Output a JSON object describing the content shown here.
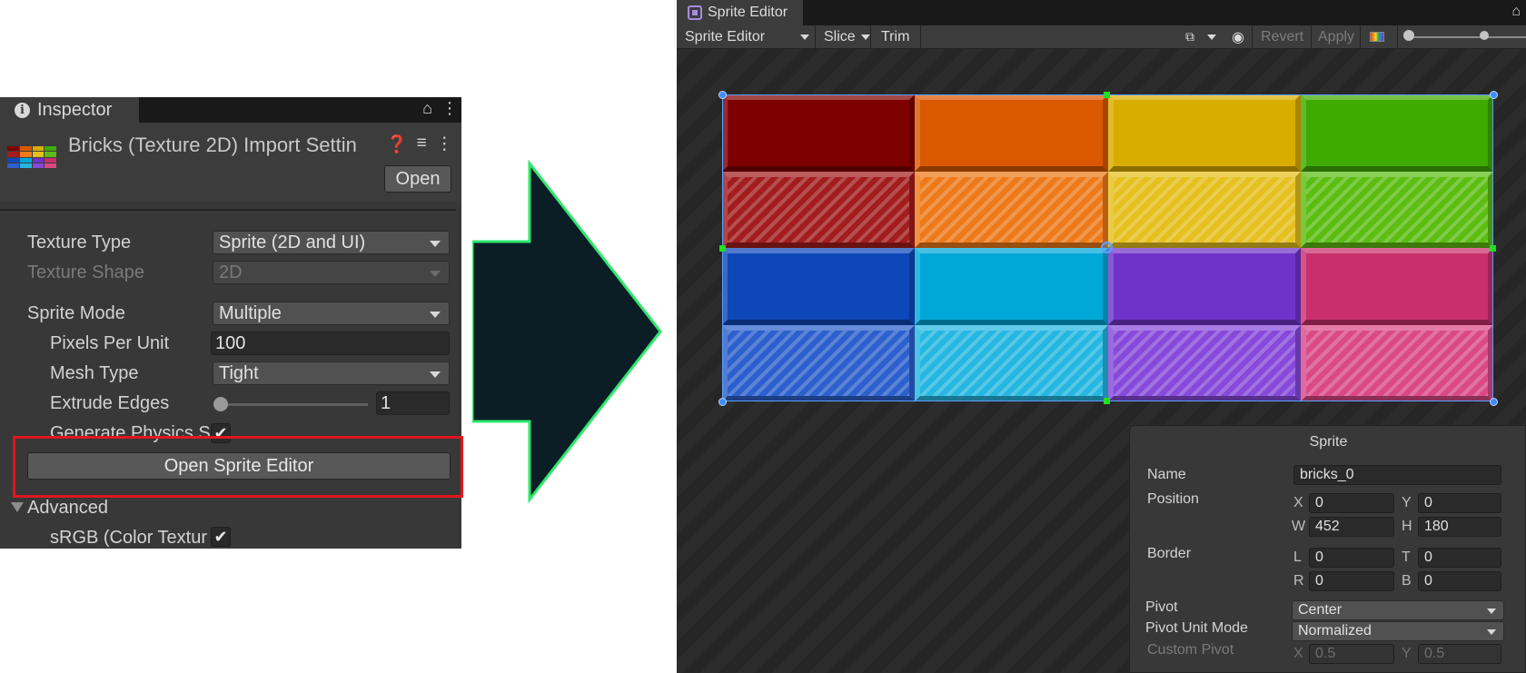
{
  "inspector": {
    "tab_label": "Inspector",
    "title": "Bricks (Texture 2D) Import Settin",
    "open_button": "Open",
    "texture_type_label": "Texture Type",
    "texture_type_value": "Sprite (2D and UI)",
    "texture_shape_label": "Texture Shape",
    "texture_shape_value": "2D",
    "sprite_mode_label": "Sprite Mode",
    "sprite_mode_value": "Multiple",
    "pixels_per_unit_label": "Pixels Per Unit",
    "pixels_per_unit_value": "100",
    "mesh_type_label": "Mesh Type",
    "mesh_type_value": "Tight",
    "extrude_edges_label": "Extrude Edges",
    "extrude_edges_value": "1",
    "generate_physics_label": "Generate Physics S",
    "generate_physics_checked": true,
    "open_sprite_editor_button": "Open Sprite Editor",
    "advanced_label": "Advanced",
    "srgb_label": "sRGB (Color Textur",
    "srgb_checked": true
  },
  "sprite_editor": {
    "tab_label": "Sprite Editor",
    "toolbar": {
      "mode_dropdown": "Sprite Editor",
      "slice": "Slice",
      "trim": "Trim",
      "revert": "Revert",
      "apply": "Apply"
    },
    "sheet": {
      "bricks": [
        {
          "color": "#7e0000",
          "striped": false
        },
        {
          "color": "#d95800",
          "striped": false
        },
        {
          "color": "#d9ac00",
          "striped": false
        },
        {
          "color": "#3faa00",
          "striped": false
        },
        {
          "color": "#a21d1d",
          "striped": true
        },
        {
          "color": "#ed7a1a",
          "striped": true
        },
        {
          "color": "#e5c01f",
          "striped": true
        },
        {
          "color": "#5bbd12",
          "striped": true
        },
        {
          "color": "#0e47b8",
          "striped": false
        },
        {
          "color": "#00a8d8",
          "striped": false
        },
        {
          "color": "#7033c9",
          "striped": false
        },
        {
          "color": "#c92f6b",
          "striped": false
        },
        {
          "color": "#2c60cc",
          "striped": true
        },
        {
          "color": "#25b7e0",
          "striped": true
        },
        {
          "color": "#8649d9",
          "striped": true
        },
        {
          "color": "#d94a85",
          "striped": true
        }
      ]
    },
    "sprite_panel": {
      "title": "Sprite",
      "name_label": "Name",
      "name_value": "bricks_0",
      "position_label": "Position",
      "x_axis": "X",
      "x_value": "0",
      "y_axis": "Y",
      "y_value": "0",
      "w_axis": "W",
      "w_value": "452",
      "h_axis": "H",
      "h_value": "180",
      "border_label": "Border",
      "l_axis": "L",
      "l_value": "0",
      "t_axis": "T",
      "t_value": "0",
      "r_axis": "R",
      "r_value": "0",
      "b_axis": "B",
      "b_value": "0",
      "pivot_label": "Pivot",
      "pivot_value": "Center",
      "pivot_unit_label": "Pivot Unit Mode",
      "pivot_unit_value": "Normalized",
      "custom_pivot_label": "Custom Pivot",
      "custom_x_axis": "X",
      "custom_x_value": "0.5",
      "custom_y_axis": "Y",
      "custom_y_value": "0.5"
    }
  },
  "colors": {
    "highlight": "#e0161f",
    "arrow_fill": "#0b1e26",
    "arrow_stroke": "#2ee86a",
    "selection_outline": "#5aa0ff",
    "handle_green": "#22dd22"
  }
}
